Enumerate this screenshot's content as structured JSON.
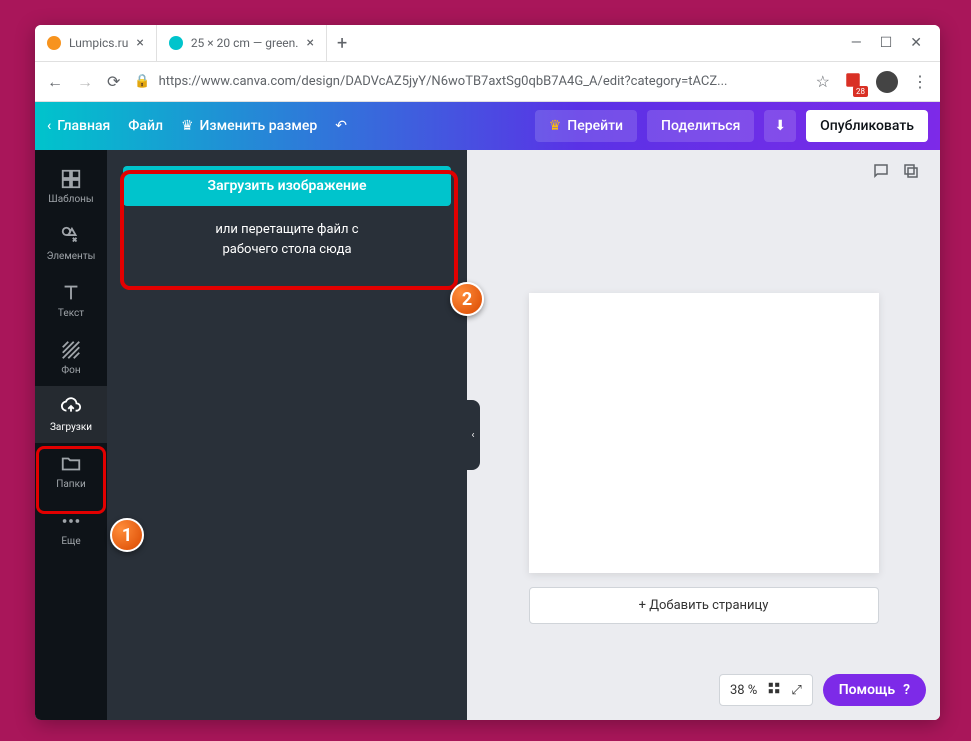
{
  "browser": {
    "tabs": [
      {
        "title": "Lumpics.ru",
        "favicon": "#f7931e"
      },
      {
        "title": "25 × 20 cm — green.",
        "favicon": "#00c4cc"
      }
    ],
    "url": "https://www.canva.com/design/DADVcAZ5jyY/N6woTB7axtSg0qbB7A4G_A/edit?category=tACZ...",
    "ext_count": "28"
  },
  "toolbar": {
    "home": "Главная",
    "file": "Файл",
    "resize": "Изменить размер",
    "upgrade": "Перейти",
    "share": "Поделиться",
    "publish": "Опубликовать"
  },
  "sidebar": {
    "items": [
      {
        "label": "Шаблоны"
      },
      {
        "label": "Элементы"
      },
      {
        "label": "Текст"
      },
      {
        "label": "Фон"
      },
      {
        "label": "Загрузки"
      },
      {
        "label": "Папки"
      },
      {
        "label": "Еще"
      }
    ]
  },
  "panel": {
    "upload_button": "Загрузить изображение",
    "hint_line1": "или перетащите файл с",
    "hint_line2": "рабочего стола сюда"
  },
  "canvas": {
    "add_page": "+ Добавить страницу",
    "zoom": "38 %"
  },
  "help": "Помощь",
  "annotations": {
    "b1": "1",
    "b2": "2"
  }
}
